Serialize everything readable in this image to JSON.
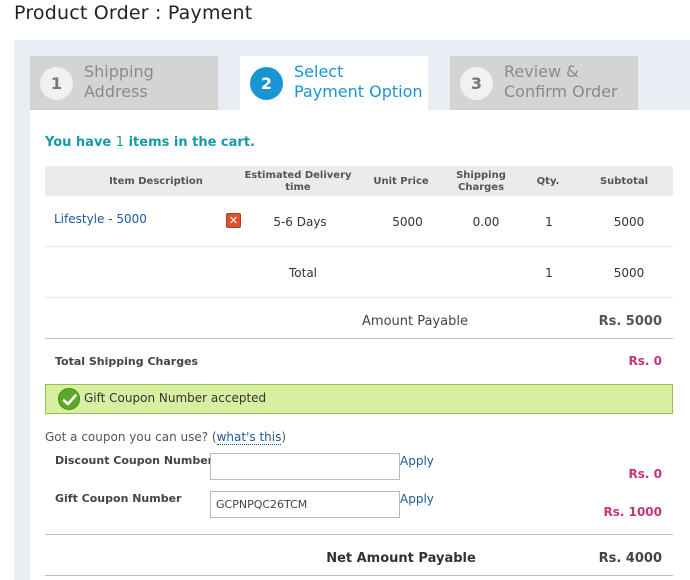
{
  "page_title": "Product Order : Payment",
  "steps": [
    {
      "number": "1",
      "line1": "Shipping",
      "line2": "Address",
      "active": false
    },
    {
      "number": "2",
      "line1": "Select",
      "line2": "Payment Option",
      "active": true
    },
    {
      "number": "3",
      "line1": "Review &",
      "line2": "Confirm Order",
      "active": false
    }
  ],
  "cart": {
    "prefix": "You have ",
    "count": "1",
    "suffix": " items in the cart."
  },
  "table": {
    "headers": {
      "item": "Item Description",
      "delivery_1": "Estimated Delivery",
      "delivery_2": "time",
      "unit_price": "Unit Price",
      "shipping_1": "Shipping",
      "shipping_2": "Charges",
      "qty": "Qty.",
      "subtotal": "Subtotal"
    },
    "row": {
      "item": "Lifestyle - 5000",
      "delivery": "5-6 Days",
      "unit_price": "5000",
      "shipping": "0.00",
      "qty": "1",
      "subtotal": "5000"
    },
    "total": {
      "label": "Total",
      "qty": "1",
      "subtotal": "5000"
    }
  },
  "amount_payable": {
    "label": "Amount Payable",
    "value": "Rs. 5000"
  },
  "shipping_total": {
    "label": "Total Shipping Charges",
    "value": "Rs. 0"
  },
  "coupon_notice": "Gift Coupon Number accepted",
  "coupon_prompt": {
    "text": "Got a coupon you can use? (",
    "link": "what's this",
    "close": ")"
  },
  "discount_coupon": {
    "label": "Discount Coupon Number",
    "value": "",
    "apply": "Apply",
    "amount": "Rs. 0"
  },
  "gift_coupon": {
    "label": "Gift Coupon Number",
    "value": "GCPNPQC26TCM",
    "apply": "Apply",
    "amount": "Rs. 1000"
  },
  "net_payable": {
    "label": "Net Amount Payable",
    "value": "Rs. 4000"
  },
  "colors": {
    "accent": "#1a95d4",
    "cart_text": "#159aa6",
    "pink": "#c3357a",
    "success_bg": "#d7efa0"
  }
}
